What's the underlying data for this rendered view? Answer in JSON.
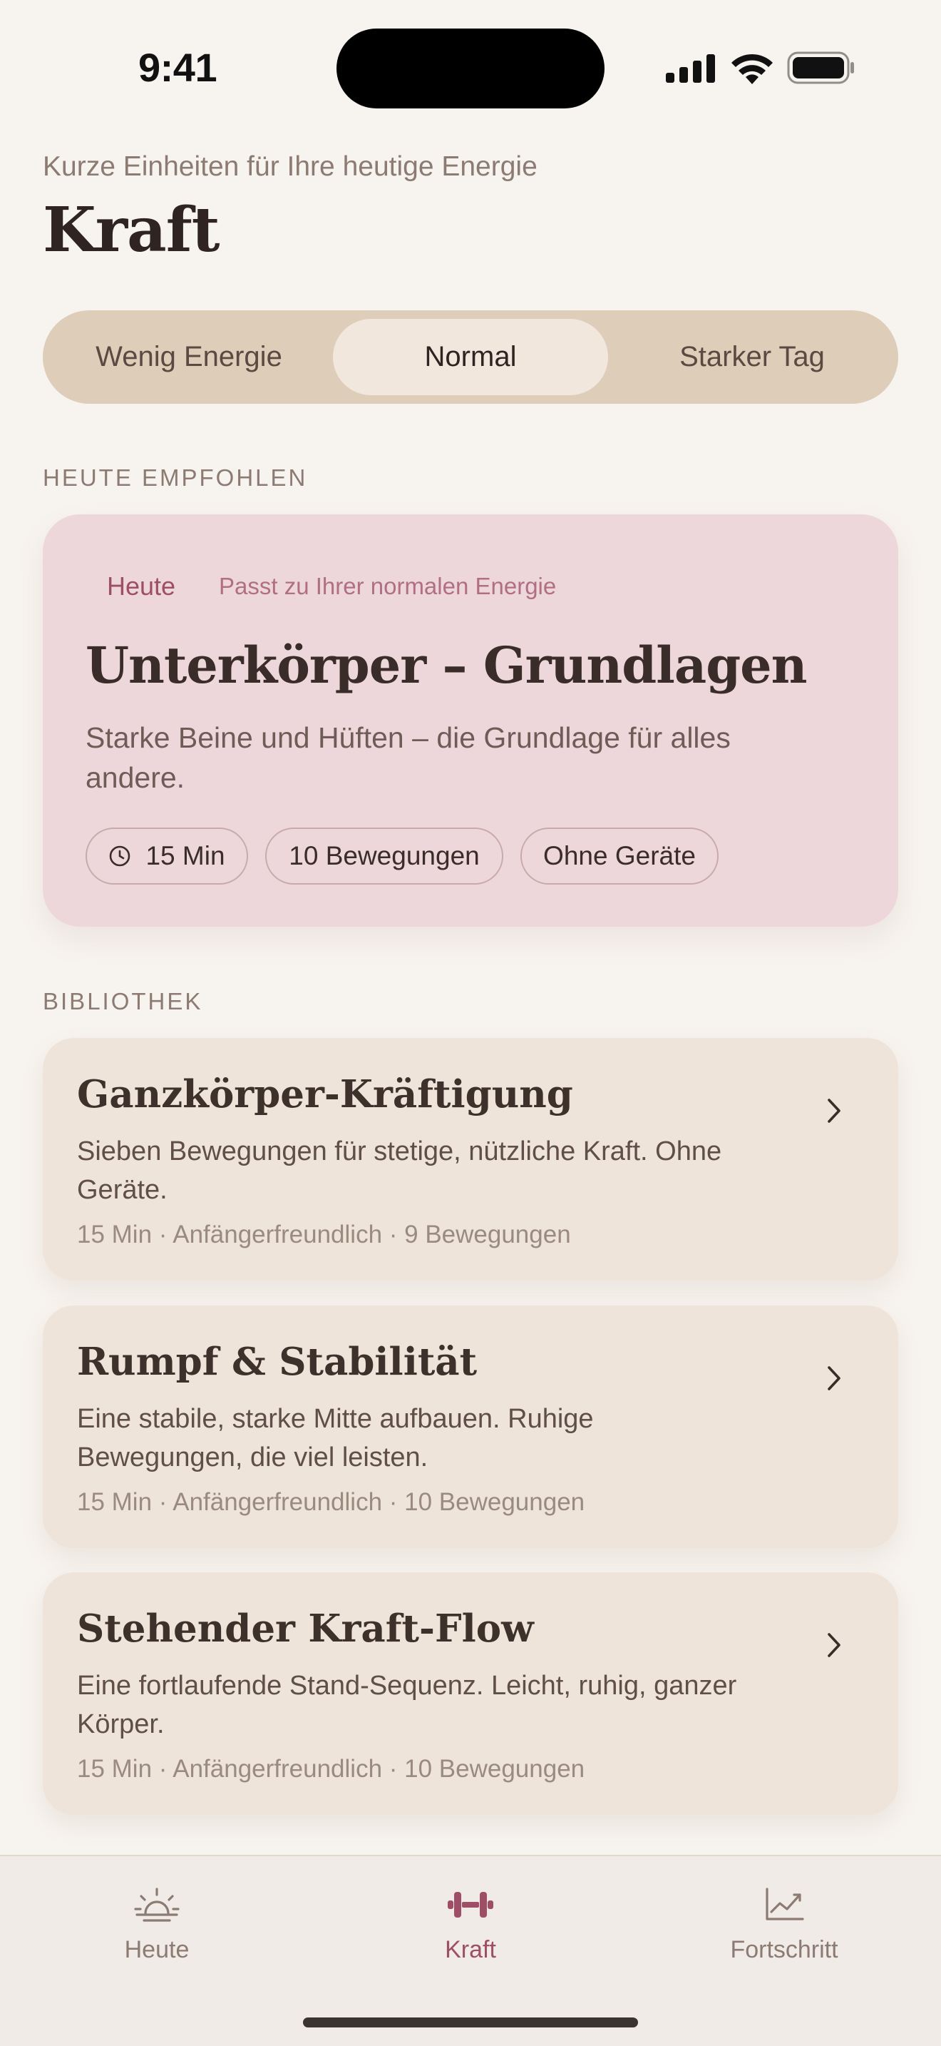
{
  "status_bar": {
    "time": "9:41",
    "icons": [
      "signal-icon",
      "wifi-icon",
      "battery-icon"
    ]
  },
  "header": {
    "subtitle": "Kurze Einheiten für Ihre heutige Energie",
    "title": "Kraft"
  },
  "energy_selector": {
    "options": [
      "Wenig Energie",
      "Normal",
      "Starker Tag"
    ],
    "selected": "Normal"
  },
  "recommended": {
    "section_label": "HEUTE EMPFOHLEN",
    "tag": "Heute",
    "note": "Passt zu Ihrer normalen Energie",
    "title": "Unterkörper – Grundlagen",
    "description": "Starke Beine und Hüften – die Grundlage für alles andere.",
    "chips": [
      "15 Min",
      "10 Bewegungen",
      "Ohne Geräte"
    ]
  },
  "library": {
    "section_label": "BIBLIOTHEK",
    "items": [
      {
        "title": "Ganzkörper-Kräftigung",
        "description": "Sieben Bewegungen für stetige, nützliche Kraft. Ohne Geräte.",
        "meta": "15 Min · Anfängerfreundlich · 9 Bewegungen"
      },
      {
        "title": "Rumpf & Stabilität",
        "description": "Eine stabile, starke Mitte aufbauen. Ruhige Bewegungen, die viel leisten.",
        "meta": "15 Min · Anfängerfreundlich · 10 Bewegungen"
      },
      {
        "title": "Stehender Kraft-Flow",
        "description": "Eine fortlaufende Stand-Sequenz. Leicht, ruhig, ganzer Körper.",
        "meta": "15 Min · Anfängerfreundlich · 10 Bewegungen"
      }
    ]
  },
  "tab_bar": {
    "items": [
      {
        "label": "Heute",
        "icon": "sunrise-icon"
      },
      {
        "label": "Kraft",
        "icon": "dumbbell-icon"
      },
      {
        "label": "Fortschritt",
        "icon": "chart-line-icon"
      }
    ],
    "active": "Kraft"
  },
  "colors": {
    "background": "#f7f3ee",
    "accent": "#9e4e67",
    "featured_card": "#eed7da",
    "library_card": "#efe4da",
    "segmented_track": "#ddcdb9"
  }
}
